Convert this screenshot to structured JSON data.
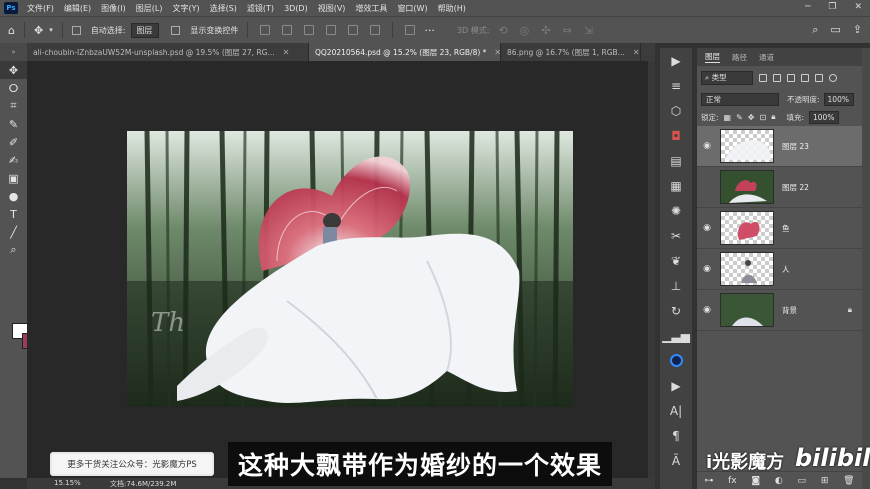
{
  "menubar": {
    "logo": "Ps",
    "items": [
      "文件(F)",
      "编辑(E)",
      "图像(I)",
      "图层(L)",
      "文字(Y)",
      "选择(S)",
      "滤镜(T)",
      "3D(D)",
      "视图(V)",
      "增效工具",
      "窗口(W)",
      "帮助(H)"
    ]
  },
  "options": {
    "auto_select_label": "自动选择:",
    "auto_select_value": "图层",
    "show_transform_label": "显示变换控件",
    "mode_3d_label": "3D 模式:"
  },
  "tabs": [
    {
      "label": "ali-choubin-IZnbzaUW52M-unsplash.psd @ 19.5% (图层 27, RG..."
    },
    {
      "label": "QQ20210564.psd @ 15.2% (图层 23, RGB/8) *"
    },
    {
      "label": "86.png @ 16.7% (图层 1, RGB..."
    }
  ],
  "status": {
    "zoom": "15.15%",
    "doc": "文档:74.6M/239.2M"
  },
  "layers_panel": {
    "tabs": [
      "图层",
      "路径",
      "通道"
    ],
    "filter_label": "类型",
    "blend_mode": "正常",
    "opacity_label": "不透明度:",
    "opacity_value": "100%",
    "lock_label": "锁定:",
    "fill_label": "填充:",
    "fill_value": "100%",
    "layers": [
      {
        "name": "图层 23",
        "visible": true,
        "selected": true
      },
      {
        "name": "图层 22",
        "visible": false,
        "selected": false
      },
      {
        "name": "鱼",
        "visible": true,
        "selected": false
      },
      {
        "name": "人",
        "visible": true,
        "selected": false
      },
      {
        "name": "背景",
        "visible": true,
        "selected": false,
        "locked": true
      }
    ]
  },
  "overlay": {
    "promo": "更多干货关注公众号：光影魔方PS",
    "subtitle": "这种大飘带作为婚纱的一个效果",
    "watermark": "i光影魔方",
    "bili": "bilibili"
  },
  "colors": {
    "foreground": "#ffffff",
    "background": "#9a3a5c"
  }
}
